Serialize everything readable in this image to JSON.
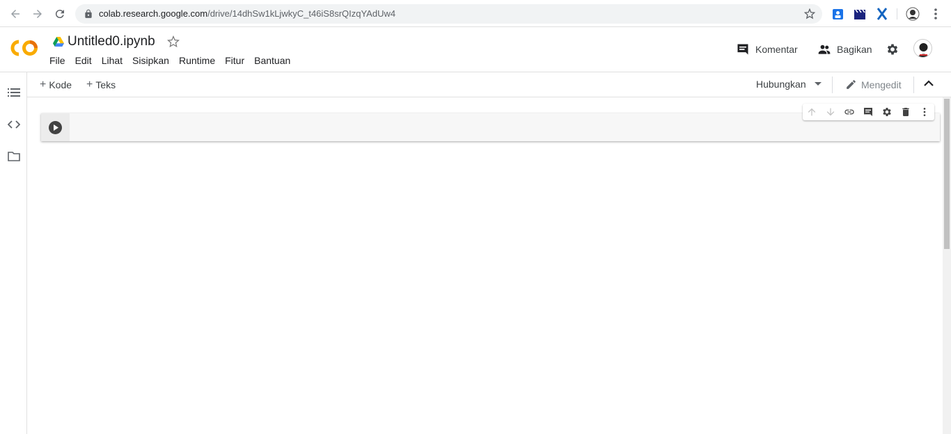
{
  "browser": {
    "url_host": "colab.research.google.com",
    "url_path": "/drive/14dhSw1kLjwkyC_t46iS8srQIzqYAdUw4"
  },
  "header": {
    "logo_text": "CO",
    "doc_title": "Untitled0.ipynb",
    "menu": [
      "File",
      "Edit",
      "Lihat",
      "Sisipkan",
      "Runtime",
      "Fitur",
      "Bantuan"
    ],
    "comment_label": "Komentar",
    "share_label": "Bagikan"
  },
  "toolbar": {
    "add_code_label": "Kode",
    "add_text_label": "Teks",
    "connect_label": "Hubungkan",
    "editing_label": "Mengedit"
  },
  "cell": {
    "code": ""
  },
  "colors": {
    "logo_orange": "#F9AB00",
    "logo_dark": "#E8710A",
    "run_button": "#424242"
  }
}
